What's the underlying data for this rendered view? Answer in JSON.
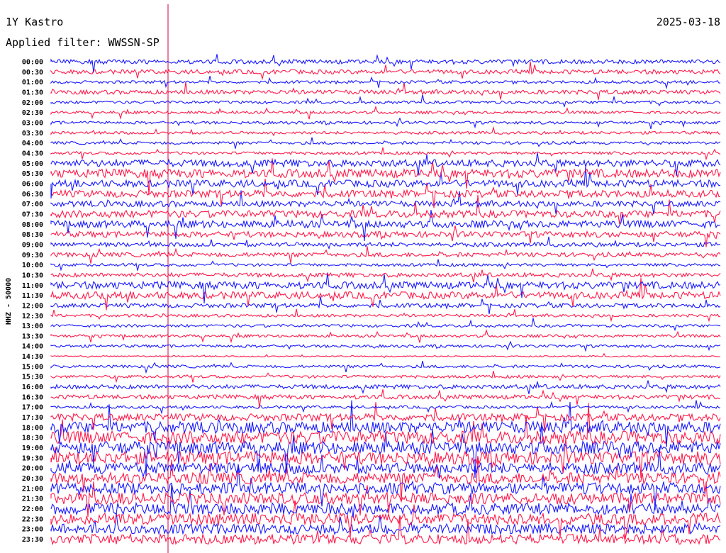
{
  "header": {
    "station": "1Y Kastro",
    "date": "2025-03-18",
    "filter": "Applied filter: WWSSN-SP"
  },
  "chart_data": {
    "type": "line",
    "title": "1Y Kastro",
    "ylabel": "HHZ - 50000",
    "colors": {
      "even_trace": "#1a1aff",
      "odd_trace": "#ff1a4a",
      "marker": "#d0004a"
    },
    "ticks": [
      "00:00",
      "00:30",
      "01:00",
      "01:30",
      "02:00",
      "02:30",
      "03:00",
      "03:30",
      "04:00",
      "04:30",
      "05:00",
      "05:30",
      "06:00",
      "06:30",
      "07:00",
      "07:30",
      "08:00",
      "08:30",
      "09:00",
      "09:30",
      "10:00",
      "10:30",
      "11:00",
      "11:30",
      "12:00",
      "12:30",
      "13:00",
      "13:30",
      "14:00",
      "14:30",
      "15:00",
      "15:30",
      "16:00",
      "16:30",
      "17:00",
      "17:30",
      "18:00",
      "18:30",
      "19:00",
      "19:30",
      "20:00",
      "20:30",
      "21:00",
      "21:30",
      "22:00",
      "22:30",
      "23:00",
      "23:30"
    ],
    "trace_noise_level": [
      3,
      3,
      2,
      3,
      2,
      2,
      2,
      2,
      2,
      2,
      5,
      6,
      5,
      5,
      4,
      5,
      5,
      4,
      3,
      3,
      2,
      3,
      5,
      5,
      3,
      2,
      2,
      2,
      2,
      1,
      2,
      2,
      3,
      3,
      2,
      5,
      8,
      9,
      9,
      9,
      8,
      8,
      8,
      8,
      8,
      8,
      7,
      7
    ]
  }
}
